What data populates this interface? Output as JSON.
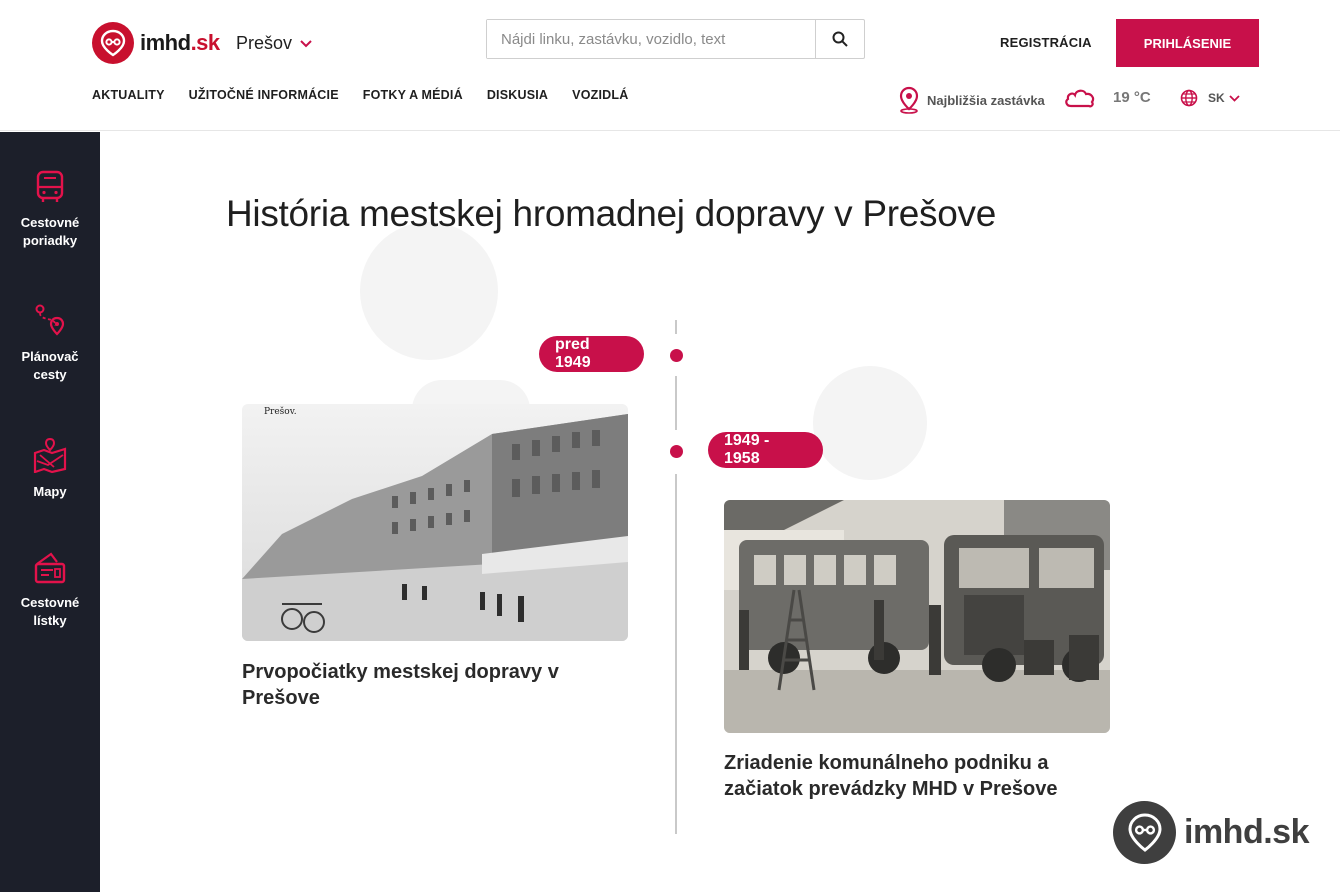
{
  "brand": {
    "name": "imhd",
    "tld": ".sk",
    "accent": "#c8104a",
    "sidebar_bg": "#1c1f2a"
  },
  "header": {
    "city": "Prešov",
    "search_placeholder": "Nájdi linku, zastávku, vozidlo, text",
    "register": "REGISTRÁCIA",
    "login": "PRIHLÁSENIE",
    "nav": [
      "AKTUALITY",
      "UŽITOČNÉ INFORMÁCIE",
      "FOTKY A MÉDIÁ",
      "DISKUSIA",
      "VOZIDLÁ"
    ],
    "nearest_stop": "Najbližšia zastávka",
    "temperature": "19 °C",
    "language": "SK"
  },
  "sidebar": {
    "items": [
      {
        "label": "Cestovné poriadky",
        "icon": "bus-icon"
      },
      {
        "label": "Plánovač cesty",
        "icon": "route-planner-icon"
      },
      {
        "label": "Mapy",
        "icon": "map-icon"
      },
      {
        "label": "Cestovné lístky",
        "icon": "ticket-icon"
      }
    ]
  },
  "main": {
    "title": "História mestskej hromadnej dopravy v Prešove",
    "timeline": [
      {
        "period": "pred 1949",
        "card_title": "Prvopočiatky mestskej dopravy v Prešove",
        "photo_caption": "Prešov."
      },
      {
        "period": "1949 - 1958",
        "card_title": "Zriadenie komunálneho podniku a začiatok prevádzky MHD v Prešove"
      }
    ]
  },
  "corner_logo": {
    "text": "imhd.sk"
  }
}
